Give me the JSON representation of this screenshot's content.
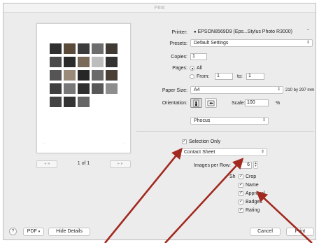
{
  "window": {
    "title": "Print"
  },
  "preview": {
    "page_count": "1 of 1",
    "prev_label": "◂ ◂",
    "next_label": "▸ ▸",
    "thumbnails": [
      "#2f2f2f",
      "#5a4a3a",
      "#3c3c3c",
      "#6d6d6d",
      "#403a34",
      "#4a4a4a",
      "#2b2b2b",
      "#7a6a5a",
      "#bdbdbd",
      "#333333",
      "#555555",
      "#9a8a7a",
      "#262626",
      "#6a6a6a",
      "#4a3f35",
      "#3f3f3f",
      "#777777",
      "#2f2f2f",
      "#585858",
      "#8d8d8d",
      "#444444",
      "#333333",
      "#666666"
    ]
  },
  "printer": {
    "label": "Printer:",
    "value": "EPSON8569D9 (Eps...Stylus Photo R3000)"
  },
  "presets": {
    "label": "Presets:",
    "value": "Default Settings"
  },
  "copies": {
    "label": "Copies:",
    "value": "1"
  },
  "pages": {
    "label": "Pages:",
    "all_label": "All",
    "from_label": "From:",
    "from_value": "1",
    "to_label": "to:",
    "to_value": "1"
  },
  "paper_size": {
    "label": "Paper Size:",
    "value": "A4",
    "dimensions": "210 by 297 mm"
  },
  "orientation": {
    "label": "Orientation:",
    "scale_label": "Scale:",
    "scale_value": "100",
    "scale_unit": "%"
  },
  "app_menu": {
    "value": "Phocus"
  },
  "selection_only": {
    "label": "Selection Only"
  },
  "layout_select": {
    "value": "Contact Sheet"
  },
  "images_per_row": {
    "label": "Images per Row:",
    "value": "6"
  },
  "show": {
    "label": "Sh",
    "options": [
      "Crop",
      "Name",
      "Approval",
      "Badges",
      "Rating"
    ]
  },
  "footer": {
    "help_label": "?",
    "pdf_label": "PDF",
    "hide_details_label": "Hide Details",
    "cancel_label": "Cancel",
    "print_label": "Print"
  },
  "colors": {
    "arrow": "#a2291f",
    "frame": "#ececec"
  }
}
